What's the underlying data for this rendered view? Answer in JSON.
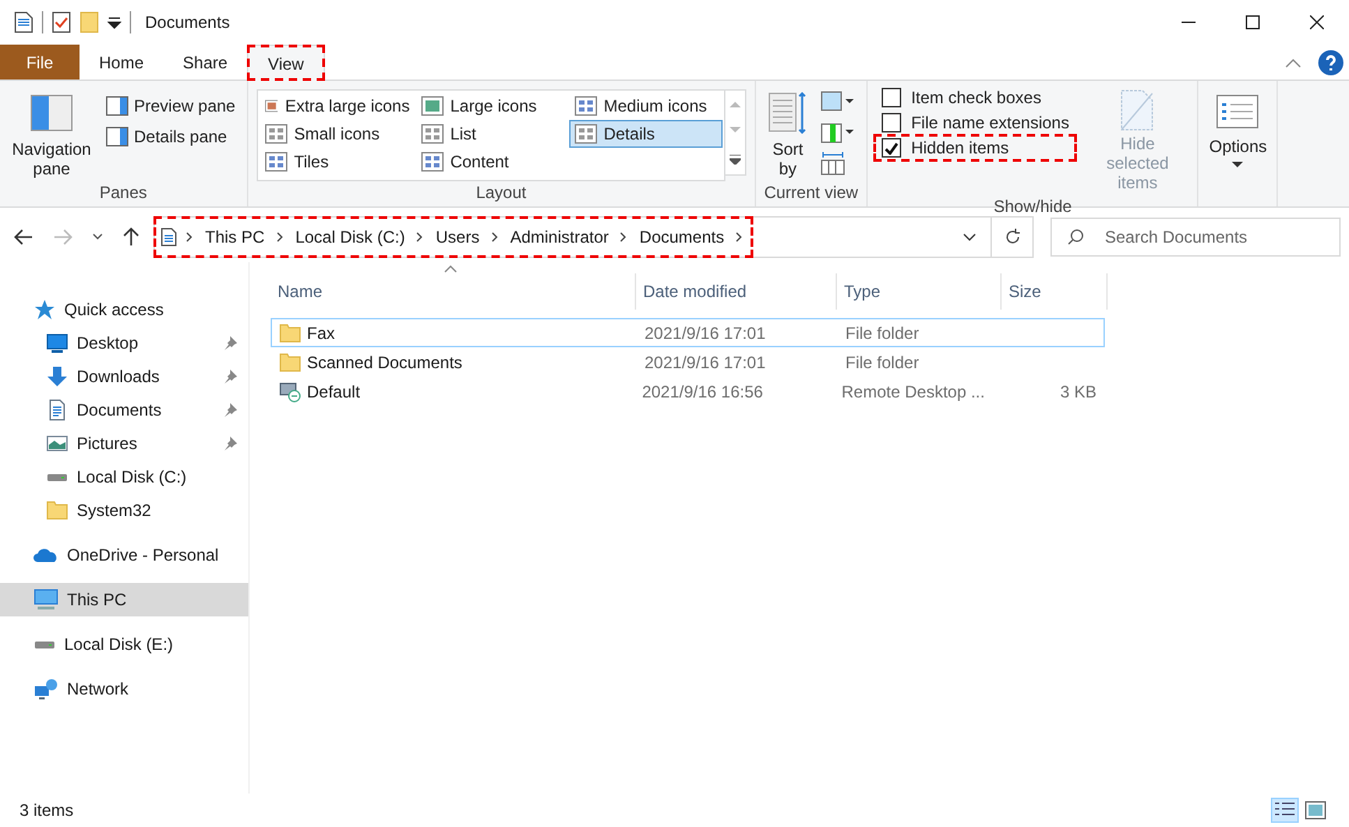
{
  "window": {
    "title": "Documents"
  },
  "ribbon_tabs": [
    {
      "label": "File",
      "kind": "file",
      "selected": false,
      "highlighted": false
    },
    {
      "label": "Home",
      "kind": "tab",
      "selected": false,
      "highlighted": false
    },
    {
      "label": "Share",
      "kind": "tab",
      "selected": false,
      "highlighted": false
    },
    {
      "label": "View",
      "kind": "tab",
      "selected": true,
      "highlighted": true
    }
  ],
  "panes": {
    "navigation_pane": "Navigation pane",
    "preview_pane": "Preview pane",
    "details_pane": "Details pane",
    "group": "Panes"
  },
  "layout": {
    "group": "Layout",
    "options": [
      {
        "label": "Extra large icons",
        "selected": false
      },
      {
        "label": "Large icons",
        "selected": false
      },
      {
        "label": "Medium icons",
        "selected": false
      },
      {
        "label": "Small icons",
        "selected": false
      },
      {
        "label": "List",
        "selected": false
      },
      {
        "label": "Details",
        "selected": true
      },
      {
        "label": "Tiles",
        "selected": false
      },
      {
        "label": "Content",
        "selected": false
      }
    ]
  },
  "current_view": {
    "sort_by": "Sort by",
    "group": "Current view"
  },
  "show_hide": {
    "group": "Show/hide",
    "options": [
      {
        "label": "Item check boxes",
        "checked": false,
        "highlighted": false
      },
      {
        "label": "File name extensions",
        "checked": false,
        "highlighted": false
      },
      {
        "label": "Hidden items",
        "checked": true,
        "highlighted": true
      }
    ],
    "hide_selected": "Hide selected items"
  },
  "options": {
    "label": "Options"
  },
  "address_bar": {
    "highlighted": true,
    "crumbs": [
      "This PC",
      "Local Disk (C:)",
      "Users",
      "Administrator",
      "Documents"
    ]
  },
  "search": {
    "placeholder": "Search Documents"
  },
  "sidebar": {
    "items": [
      {
        "label": "Quick access",
        "kind": "star",
        "selected": false,
        "children": [
          {
            "label": "Desktop",
            "kind": "desktop",
            "pinned": true,
            "selected": false
          },
          {
            "label": "Downloads",
            "kind": "download",
            "pinned": true,
            "selected": false
          },
          {
            "label": "Documents",
            "kind": "document",
            "pinned": true,
            "selected": false
          },
          {
            "label": "Pictures",
            "kind": "pictures",
            "pinned": true,
            "selected": false
          },
          {
            "label": "Local Disk (C:)",
            "kind": "drive",
            "pinned": false,
            "selected": false
          },
          {
            "label": "System32",
            "kind": "folder",
            "pinned": false,
            "selected": false
          }
        ]
      },
      {
        "label": "OneDrive - Personal",
        "kind": "cloud",
        "selected": false
      },
      {
        "label": "This PC",
        "kind": "pc",
        "selected": true
      },
      {
        "label": "Local Disk (E:)",
        "kind": "drive",
        "selected": false
      },
      {
        "label": "Network",
        "kind": "network",
        "selected": false
      }
    ]
  },
  "table": {
    "columns": [
      "Name",
      "Date modified",
      "Type",
      "Size"
    ],
    "rows": [
      {
        "name": "Fax",
        "date": "2021/9/16 17:01",
        "type": "File folder",
        "size": null,
        "kind": "folder",
        "focused": true
      },
      {
        "name": "Scanned Documents",
        "date": "2021/9/16 17:01",
        "type": "File folder",
        "size": null,
        "kind": "folder",
        "focused": false
      },
      {
        "name": "Default",
        "date": "2021/9/16 16:56",
        "type": "Remote Desktop ...",
        "size": "3 KB",
        "kind": "rdp",
        "focused": false
      }
    ]
  },
  "status_bar": {
    "count": "3 items"
  }
}
